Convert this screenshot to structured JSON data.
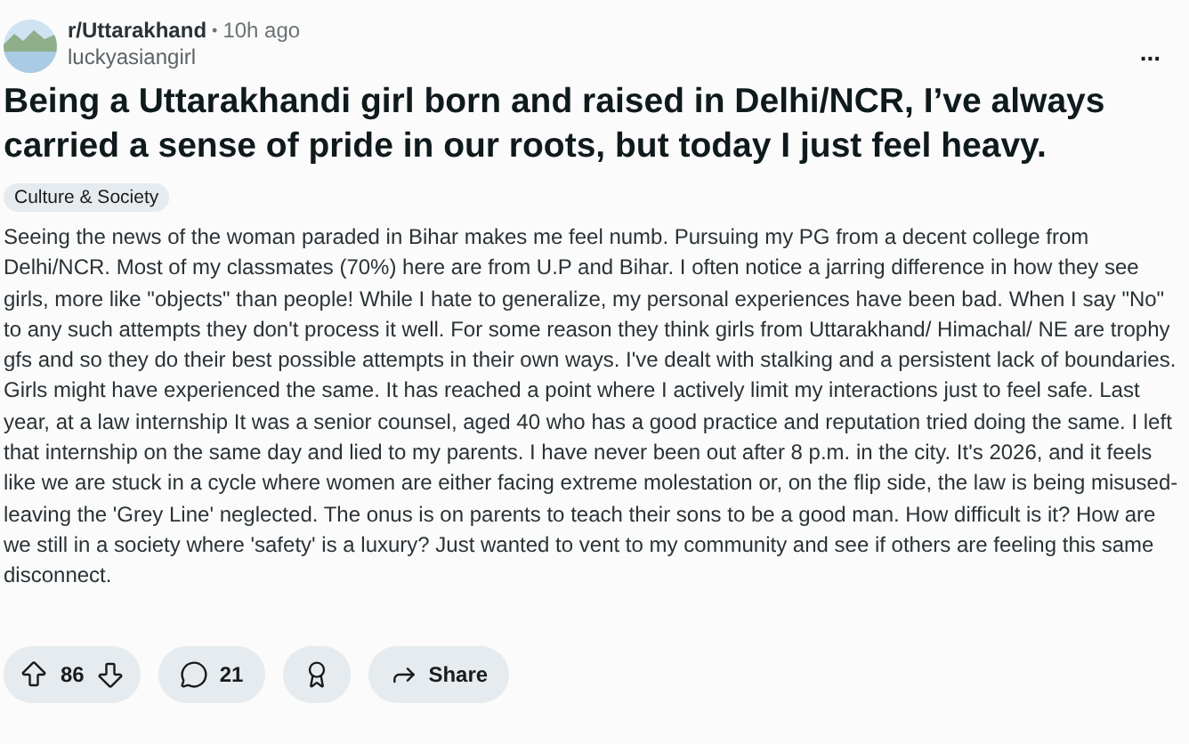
{
  "post": {
    "subreddit": "r/Uttarakhand",
    "separator": "•",
    "time": "10h ago",
    "author": "luckyasiangirl",
    "more": "...",
    "title": "Being a Uttarakhandi girl born and raised in Delhi/NCR, I’ve always carried a sense of pride in our roots, but today I just feel heavy.",
    "flair": "Culture & Society",
    "body": "Seeing the news of the woman paraded in Bihar makes me feel numb. Pursuing my PG from a decent college from Delhi/NCR. Most of my classmates (70%) here are from U.P and Bihar. I often notice a jarring difference in how they see girls, more like \"objects\" than people! While I hate to generalize, my personal experiences have been bad. When I say \"No\" to any such attempts they don't process it well. For some reason they think girls from Uttarakhand/ Himachal/ NE are trophy gfs and so they do their best possible attempts in their own ways. I've dealt with stalking and a persistent lack of boundaries. Girls might have experienced the same. It has reached a point where I actively limit my interactions just to feel safe. Last year, at a law internship It was a senior counsel, aged 40 who has a good practice and reputation tried doing the same. I left that internship on the same day and lied to my parents. I have never been out after 8 p.m. in the city. It's 2026, and it feels like we are stuck in a cycle where women are either facing extreme molestation or, on the flip side, the law is being misused- leaving the 'Grey Line' neglected. The onus is on parents to teach their sons to be a good man. How difficult is it? How are we still in a society where 'safety' is a luxury? Just wanted to vent to my community and see if others are feeling this same disconnect.",
    "votes": "86",
    "comments": "21",
    "share": "Share"
  }
}
